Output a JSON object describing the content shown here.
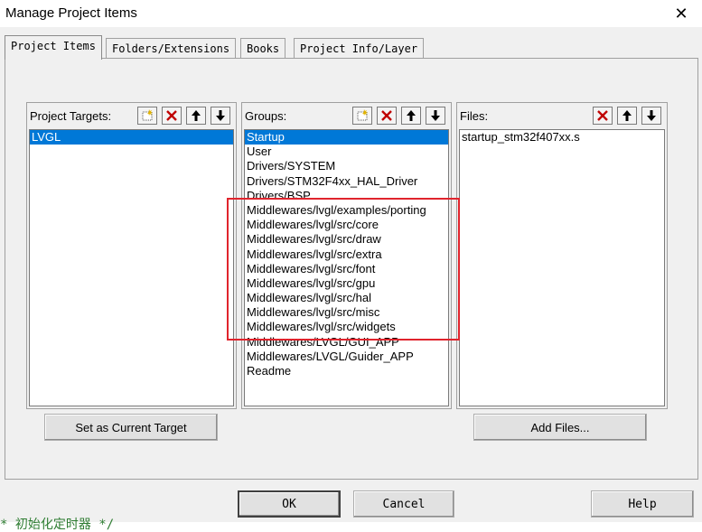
{
  "window": {
    "title": "Manage Project Items",
    "close_glyph": "✕"
  },
  "tabs": [
    {
      "label": "Project Items",
      "active": true
    },
    {
      "label": "Folders/Extensions",
      "active": false
    },
    {
      "label": "Books",
      "active": false
    },
    {
      "label": "Project Info/Layer",
      "active": false
    }
  ],
  "targets": {
    "label": "Project Targets:",
    "items": [
      "LVGL"
    ],
    "selected": "LVGL",
    "set_current_button": "Set as Current Target"
  },
  "groups": {
    "label": "Groups:",
    "items": [
      "Startup",
      "User",
      "Drivers/SYSTEM",
      "Drivers/STM32F4xx_HAL_Driver",
      "Drivers/BSP",
      "Middlewares/lvgl/examples/porting",
      "Middlewares/lvgl/src/core",
      "Middlewares/lvgl/src/draw",
      "Middlewares/lvgl/src/extra",
      "Middlewares/lvgl/src/font",
      "Middlewares/lvgl/src/gpu",
      "Middlewares/lvgl/src/hal",
      "Middlewares/lvgl/src/misc",
      "Middlewares/lvgl/src/widgets",
      "Middlewares/LVGL/GUI_APP",
      "Middlewares/LVGL/Guider_APP",
      "Readme"
    ],
    "selected": "Startup"
  },
  "files": {
    "label": "Files:",
    "items": [
      "startup_stm32f407xx.s"
    ],
    "add_files_button": "Add Files..."
  },
  "footer": {
    "ok": "OK",
    "cancel": "Cancel",
    "help": "Help"
  },
  "background_text": "*  初始化定时器 */",
  "colors": {
    "selection": "#0078d7",
    "delete_red": "#c00000",
    "highlight_box": "#e0242d"
  }
}
